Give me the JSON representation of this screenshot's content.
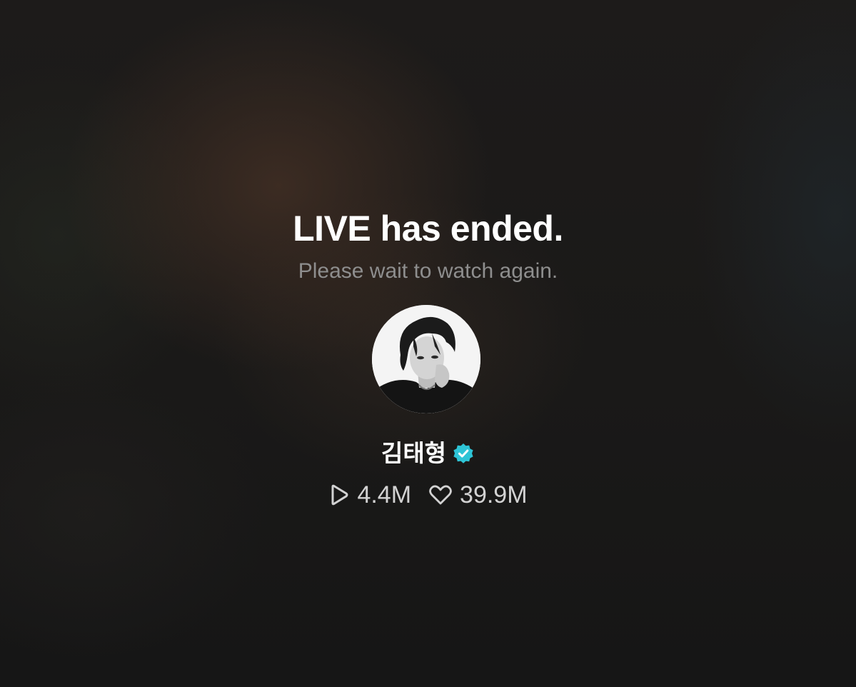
{
  "status": {
    "title": "LIVE has ended.",
    "subtitle": "Please wait to watch again."
  },
  "profile": {
    "name": "김태형",
    "verified": true,
    "verified_badge_color": "#2ec4d6",
    "avatar_icon": "profile-photo"
  },
  "stats": {
    "plays": "4.4M",
    "plays_icon": "play-icon",
    "likes": "39.9M",
    "likes_icon": "heart-icon"
  },
  "colors": {
    "background": "#171717",
    "title": "#ffffff",
    "subtitle": "#8e8e8e",
    "stats_text": "#d2d2d2"
  }
}
